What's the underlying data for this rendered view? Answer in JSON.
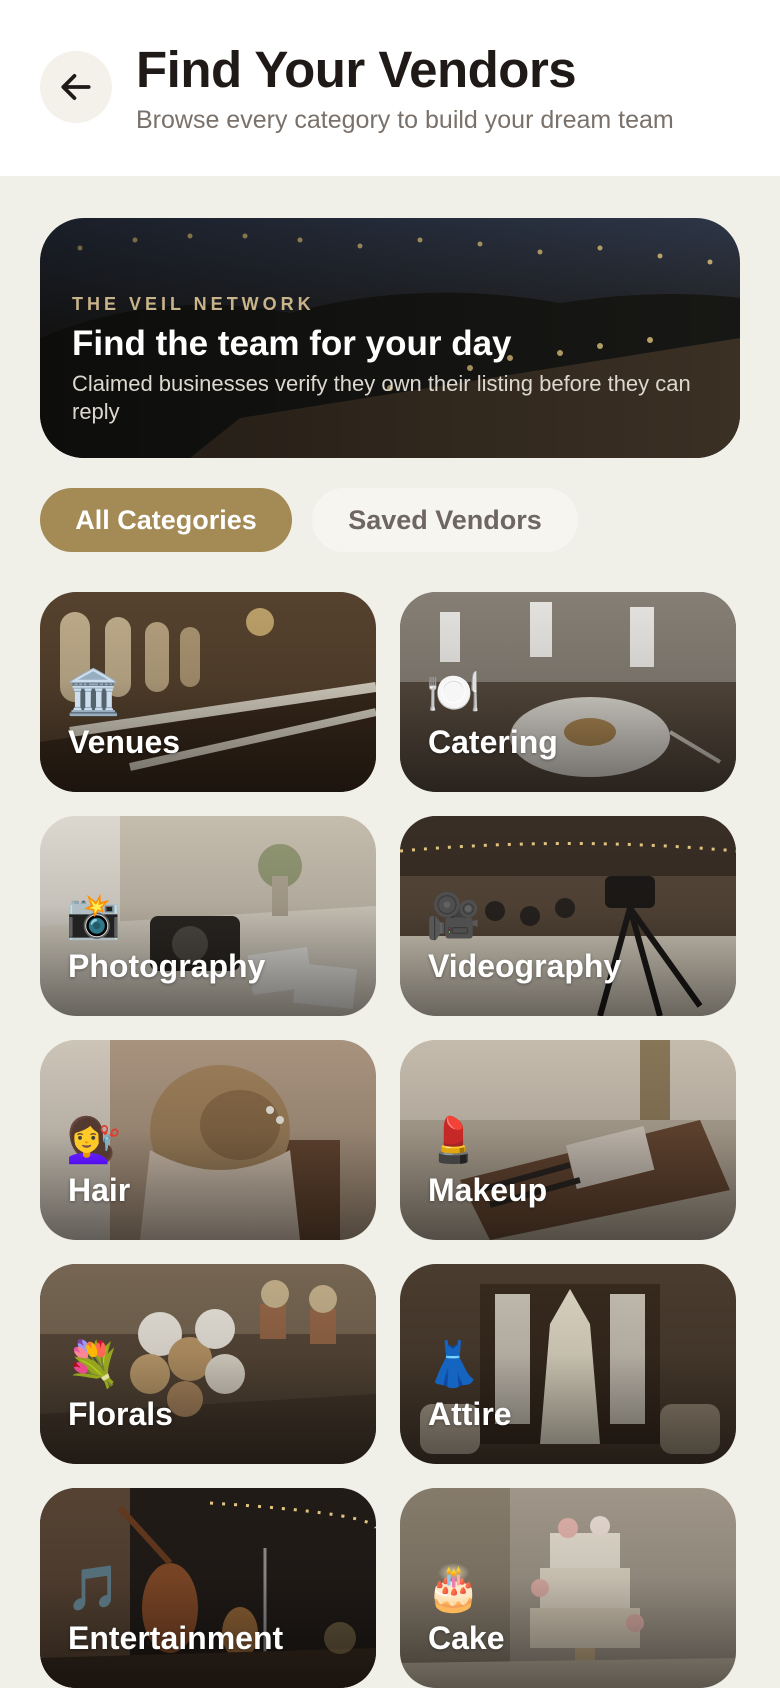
{
  "header": {
    "title": "Find Your Vendors",
    "subtitle": "Browse every category to build your dream team",
    "back_icon": "arrow-left-icon"
  },
  "hero": {
    "eyebrow": "THE VEIL NETWORK",
    "title": "Find the team for your day",
    "description": "Claimed businesses verify they own their listing before they can reply"
  },
  "filters": [
    {
      "label": "All Categories",
      "selected": true
    },
    {
      "label": "Saved Vendors",
      "selected": false
    }
  ],
  "categories": [
    {
      "label": "Venues",
      "emoji": "🏛️"
    },
    {
      "label": "Catering",
      "emoji": "🍽️"
    },
    {
      "label": "Photography",
      "emoji": "📸"
    },
    {
      "label": "Videography",
      "emoji": "🎥"
    },
    {
      "label": "Hair",
      "emoji": "💇‍♀️"
    },
    {
      "label": "Makeup",
      "emoji": "💄"
    },
    {
      "label": "Florals",
      "emoji": "💐"
    },
    {
      "label": "Attire",
      "emoji": "👗"
    },
    {
      "label": "Entertainment",
      "emoji": "🎵"
    },
    {
      "label": "Cake",
      "emoji": "🎂"
    }
  ],
  "colors": {
    "accent": "#a48a55",
    "background": "#f0f0e9",
    "title": "#1f1a17",
    "muted": "#7a716a"
  }
}
